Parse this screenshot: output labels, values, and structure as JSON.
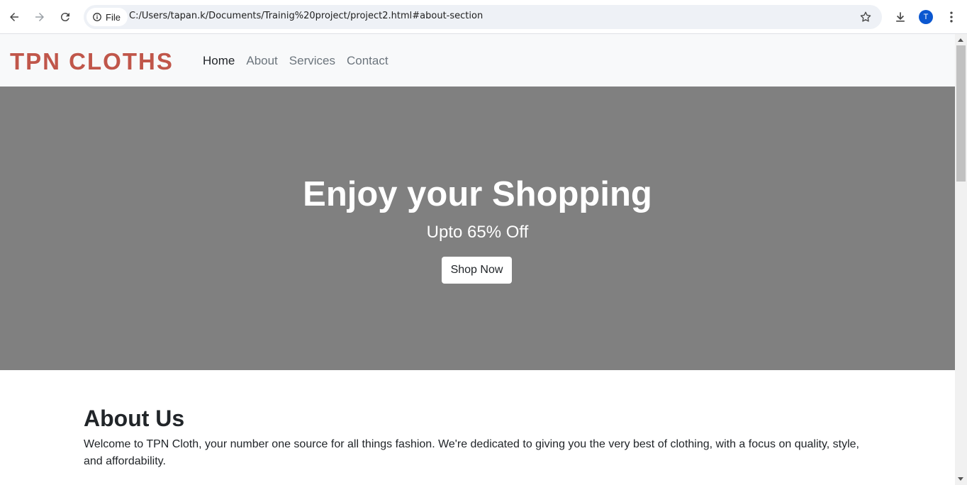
{
  "browser": {
    "chip_label": "File",
    "url": "C:/Users/tapan.k/Documents/Trainig%20project/project2.html#about-section",
    "avatar_initial": "T",
    "icons": [
      "back-icon",
      "forward-icon",
      "reload-icon",
      "info-icon",
      "star-icon",
      "download-icon",
      "menu-icon"
    ]
  },
  "site": {
    "brand": "TPN CLOTHS",
    "nav": [
      {
        "label": "Home",
        "active": true
      },
      {
        "label": "About",
        "active": false
      },
      {
        "label": "Services",
        "active": false
      },
      {
        "label": "Contact",
        "active": false
      }
    ],
    "hero": {
      "title": "Enjoy your Shopping",
      "subtitle": "Upto 65% Off",
      "button": "Shop Now"
    },
    "about": {
      "heading": "About Us",
      "text": "Welcome to TPN Cloth, your number one source for all things fashion. We're dedicated to giving you the very best of clothing, with a focus on quality, style, and affordability."
    }
  },
  "colors": {
    "brand": "#c0564a",
    "hero_bg": "#808080",
    "nav_bg": "#f8f9fa"
  }
}
